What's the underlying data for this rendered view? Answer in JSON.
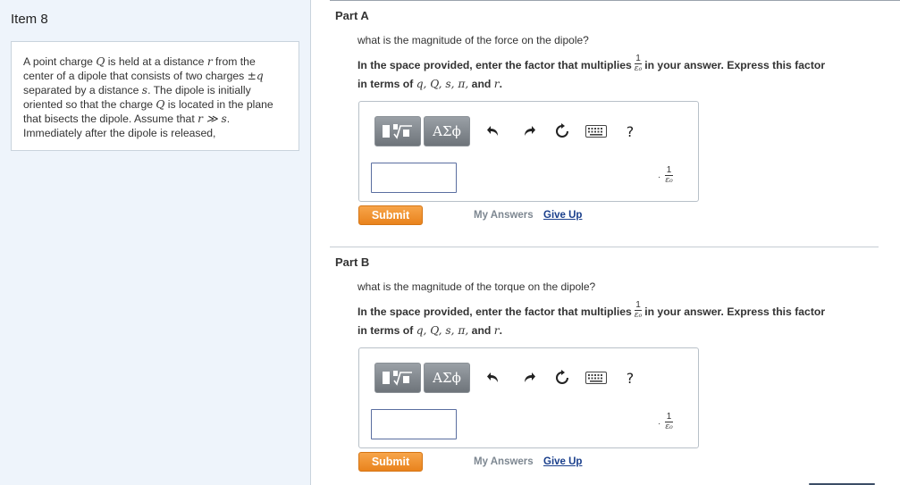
{
  "item": {
    "title": "Item 8",
    "problem_text_1": "A point charge ",
    "problem_var_Q": "Q",
    "problem_text_2": " is held at a distance ",
    "problem_var_r": "r",
    "problem_text_3": " from the center of a dipole that consists of two charges ",
    "problem_var_pmq": "±q",
    "problem_text_4": " separated by a distance ",
    "problem_var_s": "s",
    "problem_text_5": ". The dipole is initially oriented so that the charge ",
    "problem_var_Q2": "Q",
    "problem_text_6": " is located in the plane that bisects the dipole. Assume that ",
    "problem_var_cond": "r ≫ s",
    "problem_text_7": ". Immediately after the dipole is released,"
  },
  "parts": [
    {
      "title": "Part A",
      "question": "what is the magnitude of the force on the dipole?",
      "instruction_pre": "In the space provided, enter the factor that multiplies",
      "instruction_post": "in your answer. Express this factor",
      "instruction_line2_pre": "in terms of",
      "instruction_vars": "q, Q, s, π,",
      "instruction_and": "and",
      "instruction_last_var": "r",
      "instruction_end": ".",
      "frac_num": "1",
      "frac_den": "ε₀",
      "input_value": "",
      "suffix_dot": "·",
      "submit_label": "Submit",
      "my_answers_label": "My Answers",
      "give_up_label": "Give Up"
    },
    {
      "title": "Part B",
      "question": "what is the magnitude of the torque on the dipole?",
      "instruction_pre": "In the space provided, enter the factor that multiplies",
      "instruction_post": "in your answer. Express this factor",
      "instruction_line2_pre": "in terms of",
      "instruction_vars": "q, Q, s, π,",
      "instruction_and": "and",
      "instruction_last_var": "r",
      "instruction_end": ".",
      "frac_num": "1",
      "frac_den": "ε₀",
      "input_value": "",
      "suffix_dot": "·",
      "submit_label": "Submit",
      "my_answers_label": "My Answers",
      "give_up_label": "Give Up"
    }
  ],
  "toolbar": {
    "greek_label": "ΑΣϕ",
    "help_label": "?",
    "icons": [
      "templates-icon",
      "greek-letters-icon",
      "undo-icon",
      "redo-icon",
      "reset-icon",
      "keyboard-icon",
      "help-icon"
    ]
  },
  "colors": {
    "left_panel_bg": "#eef4fb",
    "submit_orange": "#e9831d",
    "link_blue": "#1a3f8c",
    "muted_gray": "#7d8791"
  }
}
